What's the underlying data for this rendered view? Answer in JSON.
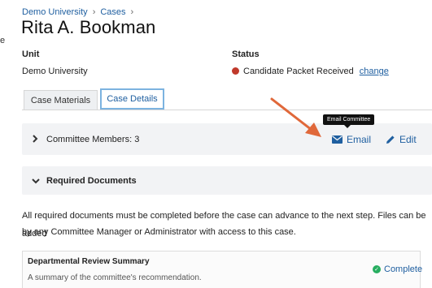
{
  "edge_mark": "e",
  "breadcrumb": {
    "items": [
      "Demo University",
      "Cases"
    ],
    "separator": "›"
  },
  "page_title": "Rita A. Bookman",
  "unit": {
    "label": "Unit",
    "value": "Demo University"
  },
  "status": {
    "label": "Status",
    "value": "Candidate Packet Received",
    "change_label": "change",
    "dot_color": "#c0392b"
  },
  "tabs": [
    {
      "label": "Case Materials",
      "active": false
    },
    {
      "label": "Case Details",
      "active": true
    }
  ],
  "committee": {
    "label": "Committee Members: 3",
    "email_label": "Email",
    "edit_label": "Edit",
    "tooltip": "Email Committee"
  },
  "required_documents": {
    "label": "Required Documents"
  },
  "info_text": {
    "line1": "All required documents must be completed before the case can advance to the next step. Files can be added",
    "line2": "by any Committee Manager or Administrator with access to this case."
  },
  "document_card": {
    "title": "Departmental Review Summary",
    "description": "A summary of the committee's recommendation.",
    "status": "Complete"
  },
  "colors": {
    "link": "#1f5fa0",
    "arrow": "#e0683a",
    "complete": "#27ae60"
  }
}
